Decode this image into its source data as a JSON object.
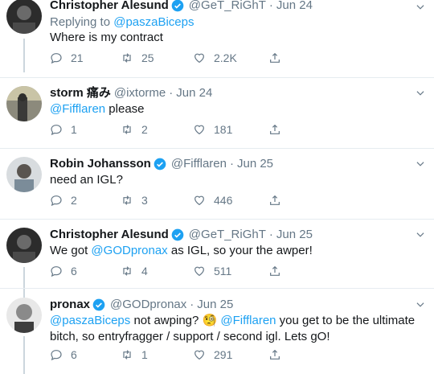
{
  "tweets": [
    {
      "name": "Christopher Alesund",
      "verified": true,
      "handle": "@GeT_RiGhT",
      "date": "Jun 24",
      "replying_label": "Replying to",
      "replying_to": "@paszaBiceps",
      "text": "Where is my contract",
      "replies": "21",
      "retweets": "25",
      "likes": "2.2K"
    },
    {
      "name": "storm 痛み",
      "verified": false,
      "handle": "@ixtorme",
      "date": "Jun 24",
      "mention": "@Fifflaren",
      "text": " please",
      "replies": "1",
      "retweets": "2",
      "likes": "181"
    },
    {
      "name": "Robin Johansson",
      "verified": true,
      "handle": "@Fifflaren",
      "date": "Jun 25",
      "text": "need an IGL?",
      "replies": "2",
      "retweets": "3",
      "likes": "446"
    },
    {
      "name": "Christopher Alesund",
      "verified": true,
      "handle": "@GeT_RiGhT",
      "date": "Jun 25",
      "text_before": "We got ",
      "mention": "@GODpronax",
      "text_after": " as IGL, so your the awper!",
      "replies": "6",
      "retweets": "4",
      "likes": "511"
    },
    {
      "name": "pronax",
      "verified": true,
      "handle": "@GODpronax",
      "date": "Jun 25",
      "mention1": "@paszaBiceps",
      "text1": " not awping? 🧐 ",
      "mention2": "@Fifflaren",
      "text2": " you get to be the ultimate",
      "text3": "bitch, so entryfragger / support / second igl. Lets gO!",
      "replies": "6",
      "retweets": "1",
      "likes": "291"
    }
  ],
  "colors": {
    "accent": "#1da1f2",
    "muted": "#657786",
    "text": "#14171a",
    "divider": "#e6ecf0"
  },
  "icons": {
    "reply": "reply-icon",
    "retweet": "retweet-icon",
    "like": "like-icon",
    "share": "share-icon",
    "verified": "verified-badge-icon",
    "menu": "chevron-down-icon"
  }
}
